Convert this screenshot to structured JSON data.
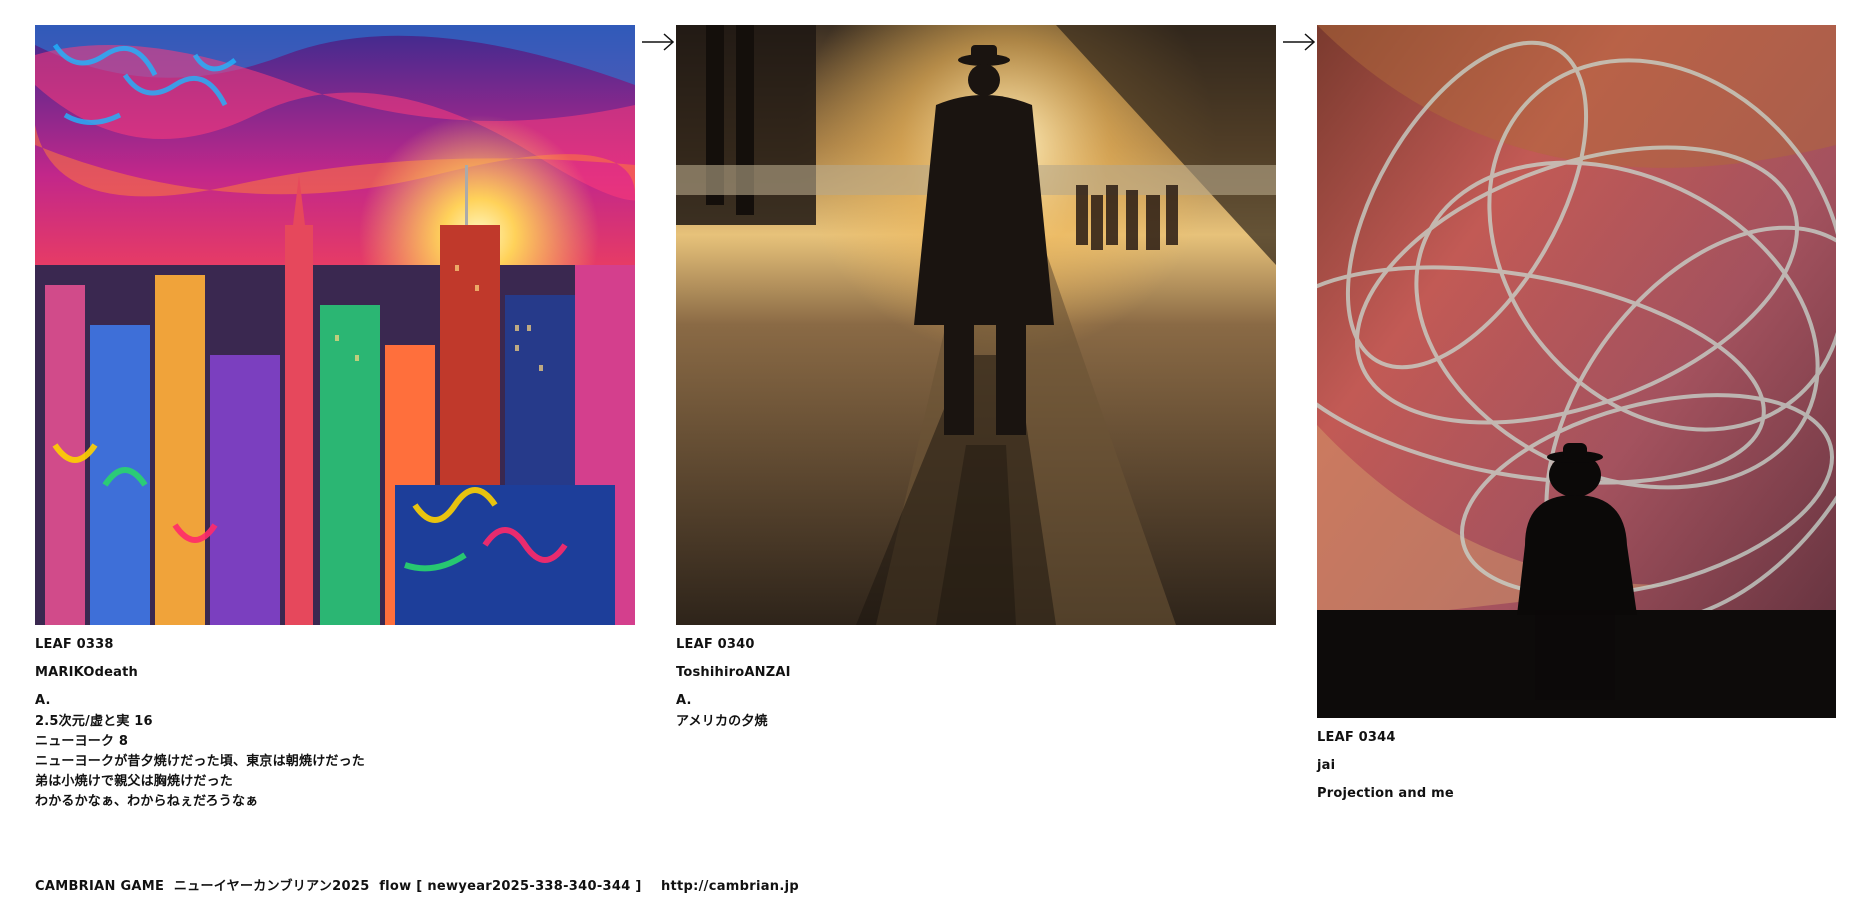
{
  "leaves": [
    {
      "id": "LEAF 0338",
      "author": "MARIKOdeath",
      "title": "A.",
      "caption": [
        "2.5次元/虚と実 16",
        "ニューヨーク 8",
        "ニューヨークが昔夕焼けだった頃、東京は朝焼けだった",
        "弟は小焼けで親父は胸焼けだった",
        "わかるかなぁ、わからねぇだろうなぁ"
      ]
    },
    {
      "id": "LEAF 0340",
      "author": "ToshihiroANZAI",
      "title": "A.",
      "caption": [
        "アメリカの夕焼"
      ]
    },
    {
      "id": "LEAF 0344",
      "author": "jai",
      "title": "Projection and me",
      "caption": []
    }
  ],
  "footer": "CAMBRIAN GAME  ニューイヤーカンブリアン2025  flow [ newyear2025-338-340-344 ]    http://cambrian.jp"
}
